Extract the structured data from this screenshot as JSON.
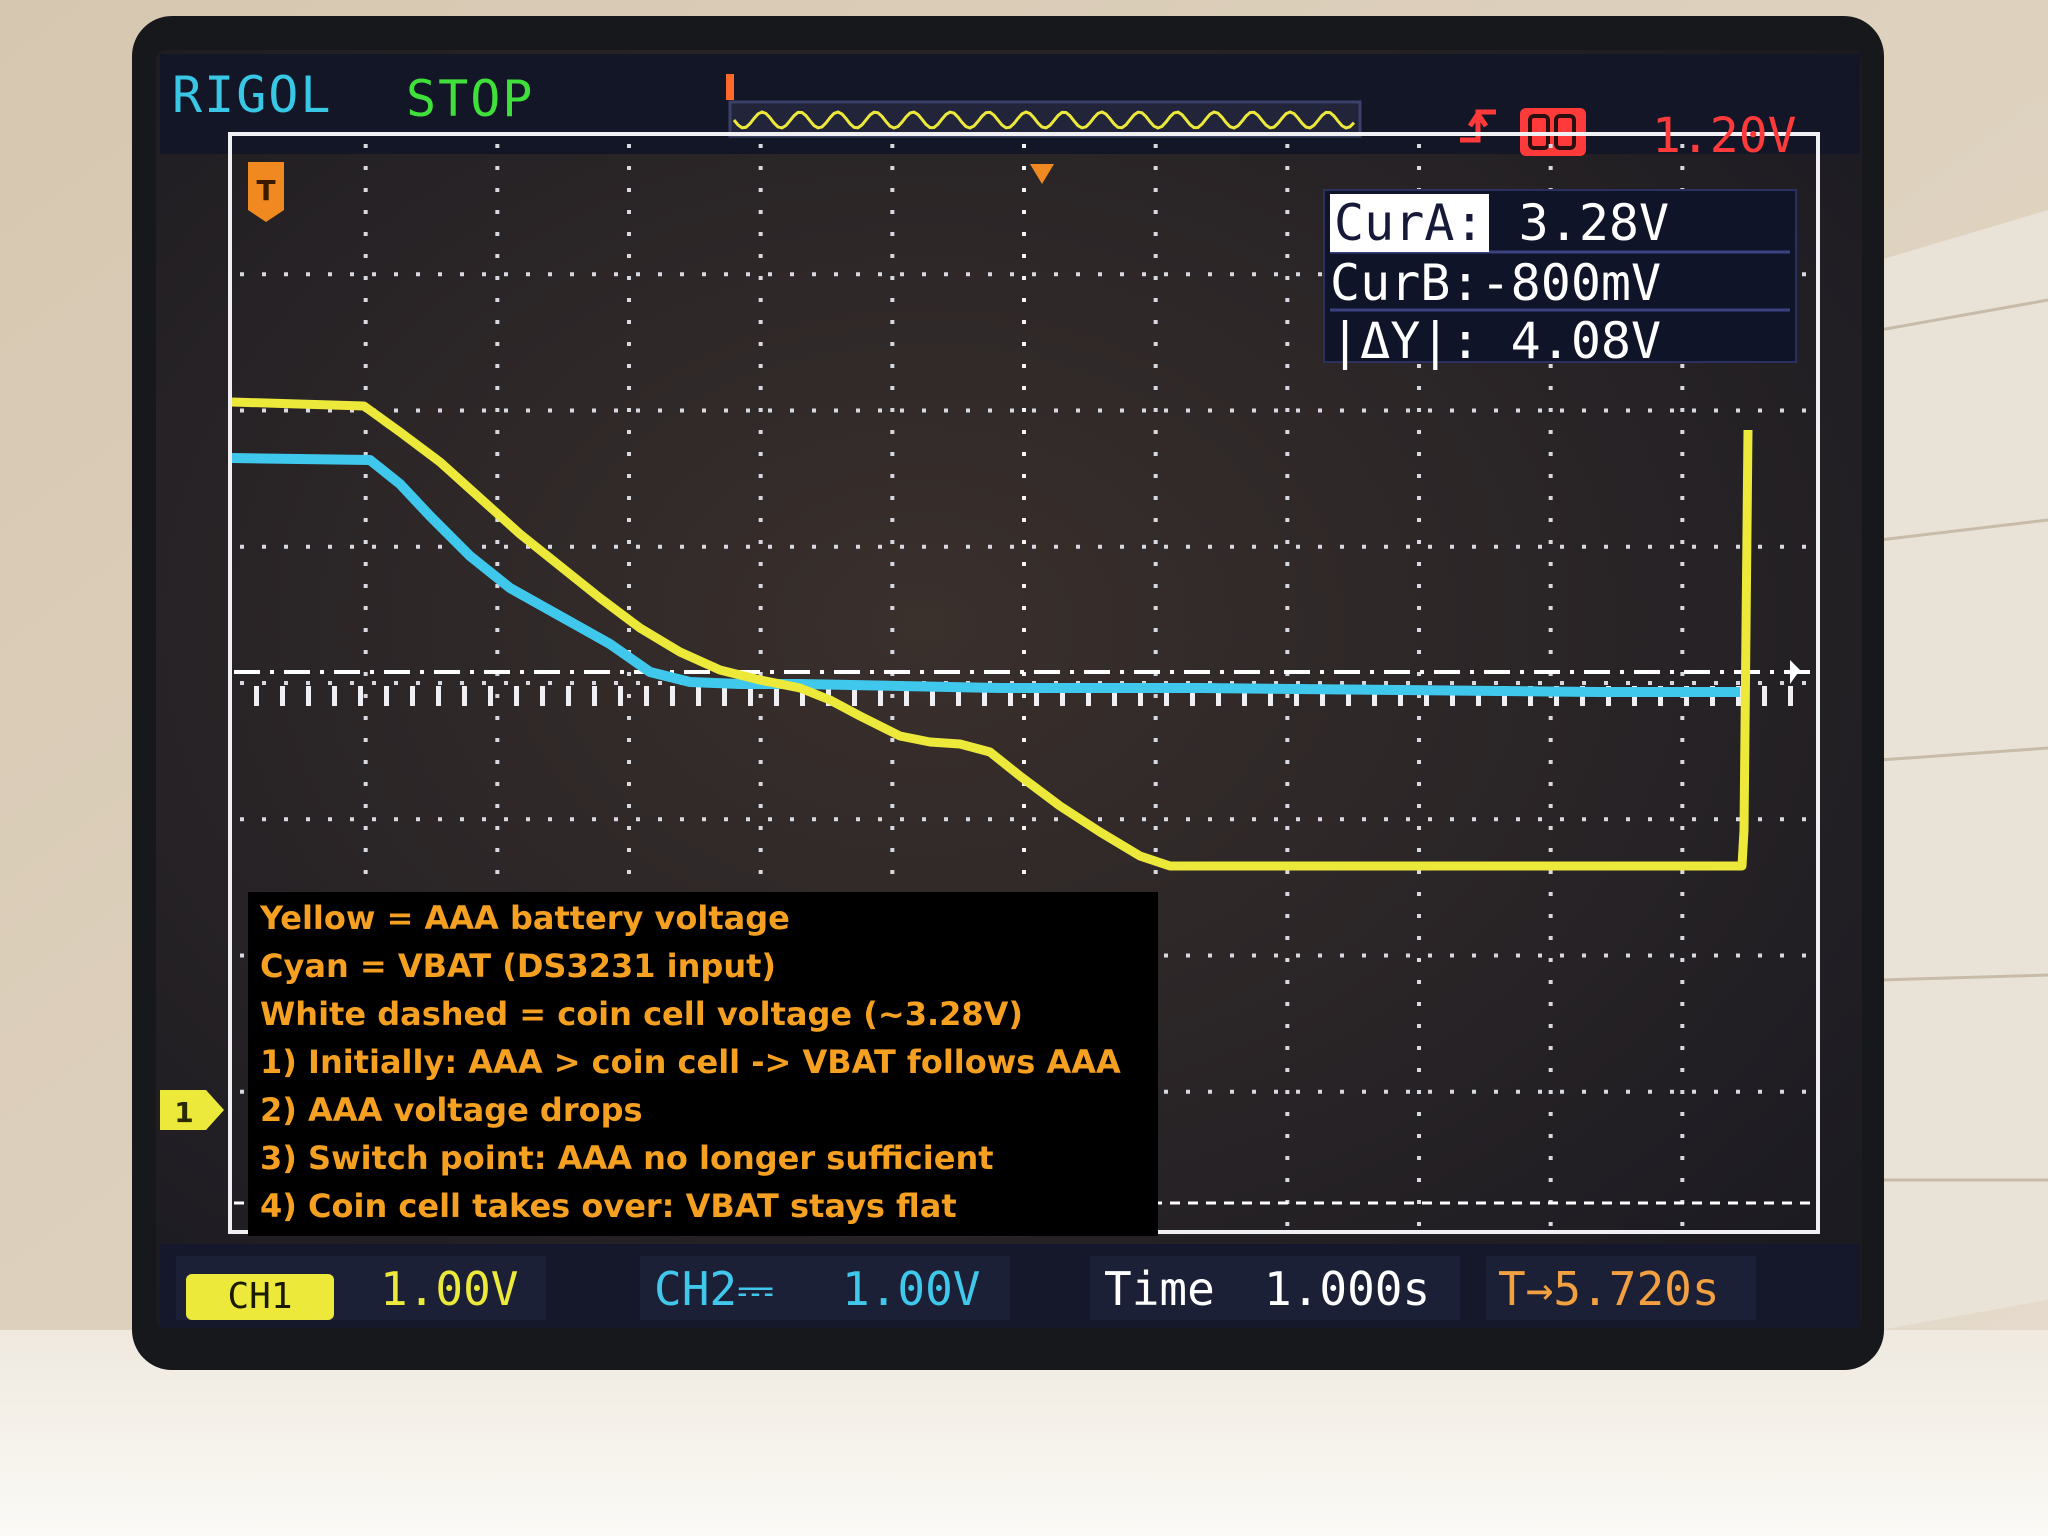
{
  "scope": {
    "brand": "RIGOL",
    "run_status": "STOP",
    "trigger_level": "1.20V",
    "cursors": {
      "cur_a_label": "CurA:",
      "cur_a_value": "3.28V",
      "cur_b_label": "CurB:",
      "cur_b_value": "-800mV",
      "delta_label": "|ΔY|:",
      "delta_value": "4.08V"
    },
    "bottom_bar": {
      "ch1_label": "CH1",
      "ch1_scale": "1.00V",
      "ch2_label": "CH2⎓",
      "ch2_scale": "1.00V",
      "time_label": "Time",
      "time_scale": "1.000s",
      "trigger_offset": "T→5.720s"
    }
  },
  "annotation": {
    "lines": [
      "Yellow = AAA battery voltage",
      "Cyan = VBAT (DS3231 input)",
      "White dashed = coin cell voltage (~3.28V)",
      "1) Initially: AAA > coin cell -> VBAT follows AAA",
      "2) AAA voltage drops",
      "3) Switch point: AAA no longer sufficient",
      "4) Coin cell takes over: VBAT stays flat"
    ]
  },
  "colors": {
    "ch1_yellow": "#ece93a",
    "ch2_cyan": "#3fc8ec",
    "cursor_white": "#ffffff",
    "annotation_orange": "#f5a020",
    "trigger_red": "#ff3a3a"
  },
  "icons": [
    "trigger-marker-icon",
    "ch2-ground-marker-icon",
    "trigger-edge-icon",
    "memory-depth-icon"
  ]
}
